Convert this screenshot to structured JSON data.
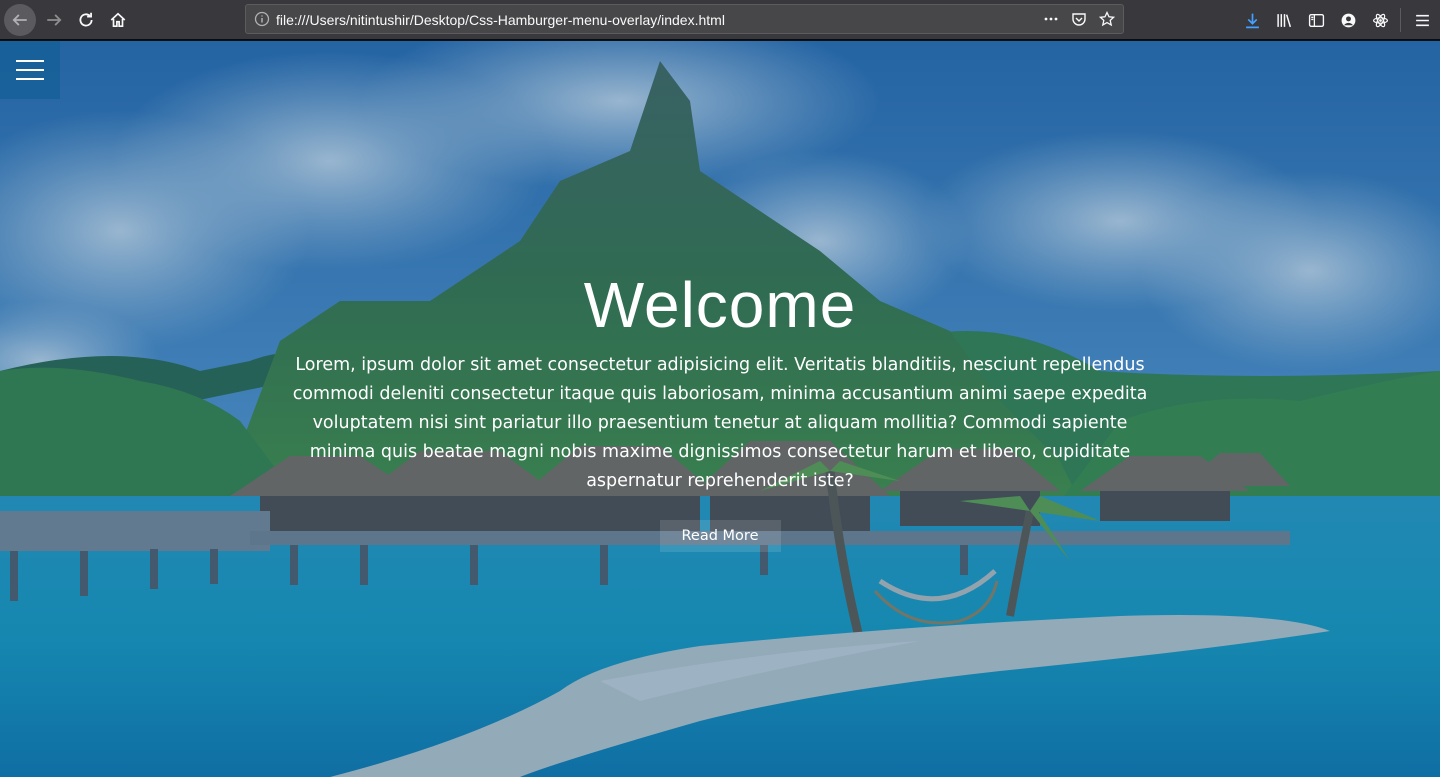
{
  "browser": {
    "url": "file:///Users/nitintushir/Desktop/Css-Hamburger-menu-overlay/index.html",
    "icons": {
      "back": "back-arrow-icon",
      "forward": "forward-arrow-icon",
      "reload": "reload-icon",
      "home": "home-icon",
      "info": "info-icon",
      "more": "more-actions-icon",
      "pocket": "pocket-icon",
      "bookmark": "bookmark-star-icon",
      "download": "download-icon",
      "library": "library-icon",
      "sidebar": "sidebar-icon",
      "account": "account-icon",
      "extension": "react-devtools-icon",
      "menu": "app-menu-icon"
    },
    "accent": "#45a1ff"
  },
  "page": {
    "hero": {
      "title": "Welcome",
      "text": "Lorem, ipsum dolor sit amet consectetur adipisicing elit. Veritatis blanditiis, nesciunt repellendus commodi deleniti consectetur itaque quis laboriosam, minima accusantium animi saepe expedita voluptatem nisi sint pariatur illo praesentium tenetur at aliquam mollitia? Commodi sapiente minima quis beatae magni nobis maxime dignissimos consectetur harum et libero, cupiditate aspernatur reprehenderit iste?",
      "button_label": "Read More"
    },
    "menu_icon": "hamburger-menu-icon",
    "overlay_color": "#145a8c"
  }
}
